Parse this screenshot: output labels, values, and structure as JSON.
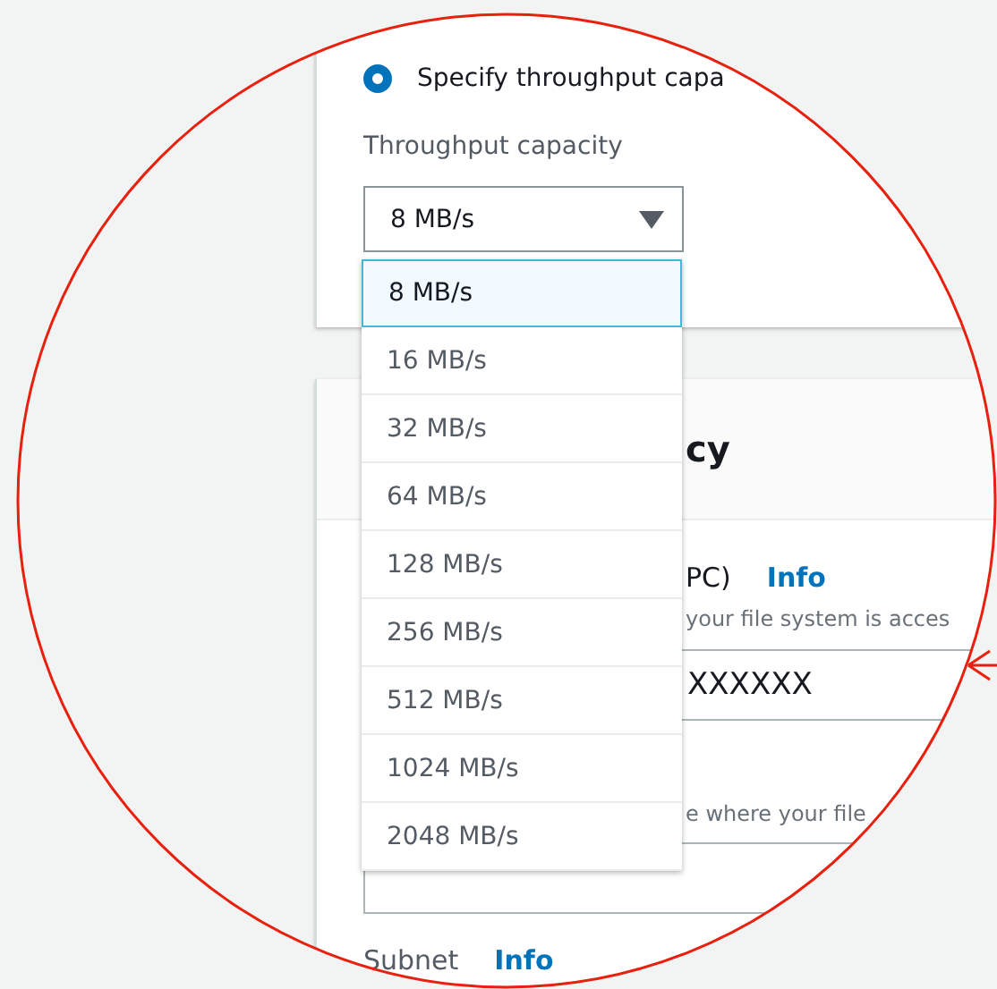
{
  "throughput_panel": {
    "radio": {
      "label": "Specify throughput capa",
      "selected": true
    },
    "field_label": "Throughput capacity",
    "select": {
      "value": "8 MB/s",
      "expanded": true
    },
    "options": [
      {
        "label": "8 MB/s",
        "selected": true
      },
      {
        "label": "16 MB/s",
        "selected": false
      },
      {
        "label": "32 MB/s",
        "selected": false
      },
      {
        "label": "64 MB/s",
        "selected": false
      },
      {
        "label": "128 MB/s",
        "selected": false
      },
      {
        "label": "256 MB/s",
        "selected": false
      },
      {
        "label": "512 MB/s",
        "selected": false
      },
      {
        "label": "1024 MB/s",
        "selected": false
      },
      {
        "label": "2048 MB/s",
        "selected": false
      }
    ]
  },
  "network_panel": {
    "heading": "cy",
    "vpc": {
      "label": "PC)",
      "info": "Info",
      "description": "your file system is acces",
      "value": "XXXXXX"
    },
    "zone": {
      "description": "e where your file"
    },
    "subnet": {
      "label": "Subnet",
      "info": "Info"
    }
  }
}
